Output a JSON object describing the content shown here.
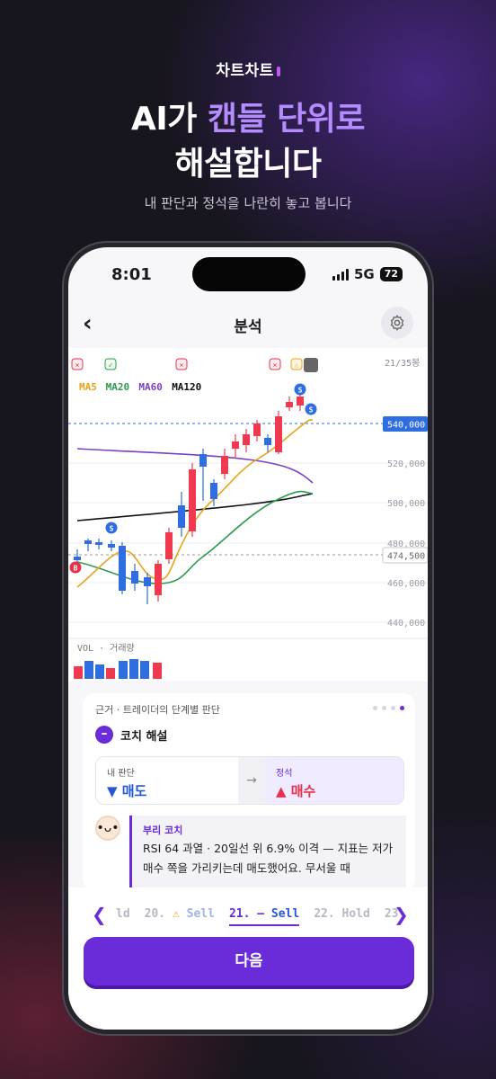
{
  "promo": {
    "brand": "차트차트",
    "headline_line1_a": "AI가 ",
    "headline_line1_b": "캔들 단위로",
    "headline_line2": "해설합니다",
    "subline": "내 판단과 정석을 나란히 놓고 봅니다",
    "accent_color": "#b58cff"
  },
  "status_bar": {
    "time": "8:01",
    "network": "5G",
    "battery": "72"
  },
  "nav": {
    "back_icon": "chevron-left-icon",
    "title": "분석",
    "settings_icon": "gear-icon"
  },
  "chart": {
    "counter": "21/35봉",
    "legend": [
      {
        "label": "MA5",
        "color": "#e8a317"
      },
      {
        "label": "MA20",
        "color": "#2e9a4e"
      },
      {
        "label": "MA60",
        "color": "#7b3fc4"
      },
      {
        "label": "MA120",
        "color": "#111111"
      }
    ],
    "price_current": "540,000",
    "price_ref": "474,500",
    "y_ticks": [
      "520,000",
      "500,000",
      "480,000",
      "460,000",
      "440,000"
    ],
    "volume_label": "VOL · 거래량",
    "up_color": "#f0394f",
    "down_color": "#2f6ee0"
  },
  "panel": {
    "title": "근거 · 트레이더의 단계별 판단",
    "coach_heading": "코치 해설",
    "mine_label": "내 판단",
    "mine_value": "▼ 매도",
    "std_label": "정석",
    "std_value": "▲ 매수",
    "coach_name": "부리 코치",
    "coach_msg": "RSI 64 과열 · 20일선 위 6.9% 이격 — 지표는 저가 매수 쪽을 가리키는데 매도했어요. 무서울 때"
  },
  "timeline": {
    "items": [
      {
        "num": "ld",
        "sep": "",
        "act": ""
      },
      {
        "num": "20.",
        "sep": "⚠",
        "act": "Sell"
      },
      {
        "num": "21.",
        "sep": "—",
        "act": "Sell"
      },
      {
        "num": "22.",
        "sep": "",
        "act": "Hold"
      },
      {
        "num": "23",
        "sep": "",
        "act": ""
      }
    ]
  },
  "next_button": "다음"
}
